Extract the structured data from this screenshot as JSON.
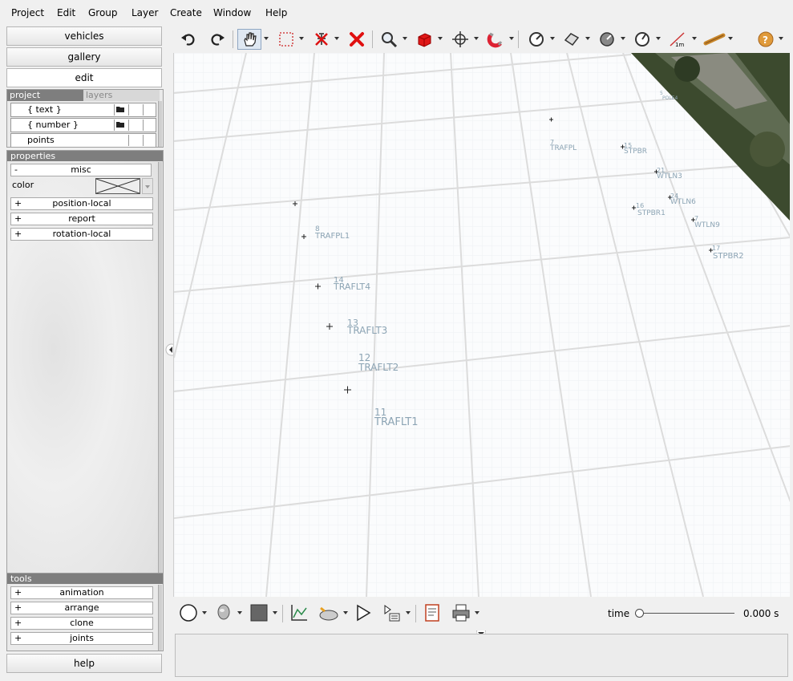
{
  "menu": [
    "Project",
    "Edit",
    "Group",
    "Layer",
    "Create",
    "Window",
    "Help"
  ],
  "nav": {
    "vehicles": "vehicles",
    "gallery": "gallery",
    "edit": "edit",
    "help": "help"
  },
  "project_panel": {
    "tabs": [
      "project",
      "layers"
    ],
    "rows": [
      "{ text }",
      "{ number }",
      "points"
    ]
  },
  "properties": {
    "header": "properties",
    "misc": {
      "sign": "-",
      "label": "misc"
    },
    "color_label": "color",
    "groups": [
      {
        "sign": "+",
        "label": "position-local"
      },
      {
        "sign": "+",
        "label": "report"
      },
      {
        "sign": "+",
        "label": "rotation-local"
      }
    ]
  },
  "tools": {
    "header": "tools",
    "items": [
      {
        "sign": "+",
        "label": "animation"
      },
      {
        "sign": "+",
        "label": "arrange"
      },
      {
        "sign": "+",
        "label": "clone"
      },
      {
        "sign": "+",
        "label": "joints"
      }
    ]
  },
  "toolbar_icons": [
    "undo-icon",
    "redo-icon",
    "pan-hand-icon",
    "select-box-icon",
    "delete-selection-icon",
    "delete-icon",
    "zoom-icon",
    "cube-icon",
    "move-icon",
    "magnet-icon",
    "measure-icon",
    "surface-icon",
    "disc-icon",
    "dial-icon",
    "scale-1m-icon",
    "tape-icon",
    "help-icon"
  ],
  "toolbar_scale_label": "1m",
  "scene_labels": [
    {
      "num": "11",
      "name": "TRAFLT1"
    },
    {
      "num": "12",
      "name": "TRAFLT2"
    },
    {
      "num": "13",
      "name": "TRAFLT3"
    },
    {
      "num": "14",
      "name": "TRAFLT4"
    },
    {
      "num": "8",
      "name": "TRAFPL1"
    },
    {
      "num": "7",
      "name": "TRAFPL"
    },
    {
      "num": "15",
      "name": "STPBR"
    },
    {
      "num": "21",
      "name": "WTLN3"
    },
    {
      "num": "24",
      "name": "WTLN6"
    },
    {
      "num": "16",
      "name": "STPBR1"
    },
    {
      "num": "7",
      "name": "WTLN9"
    },
    {
      "num": "17",
      "name": "STPBR2"
    },
    {
      "num": "5",
      "name": "POLE4"
    }
  ],
  "bottom": {
    "icons": [
      "circle-icon",
      "head-icon",
      "square-icon",
      "graph-icon",
      "vehicle-icon",
      "play-icon",
      "playlist-icon",
      "report-icon",
      "print-icon"
    ],
    "time_label": "time",
    "time_value": "0.000 s"
  },
  "colors": {
    "panel_header": "#7e7e7e",
    "label": "#8ca4b4",
    "grid": "#dcdcdc"
  }
}
